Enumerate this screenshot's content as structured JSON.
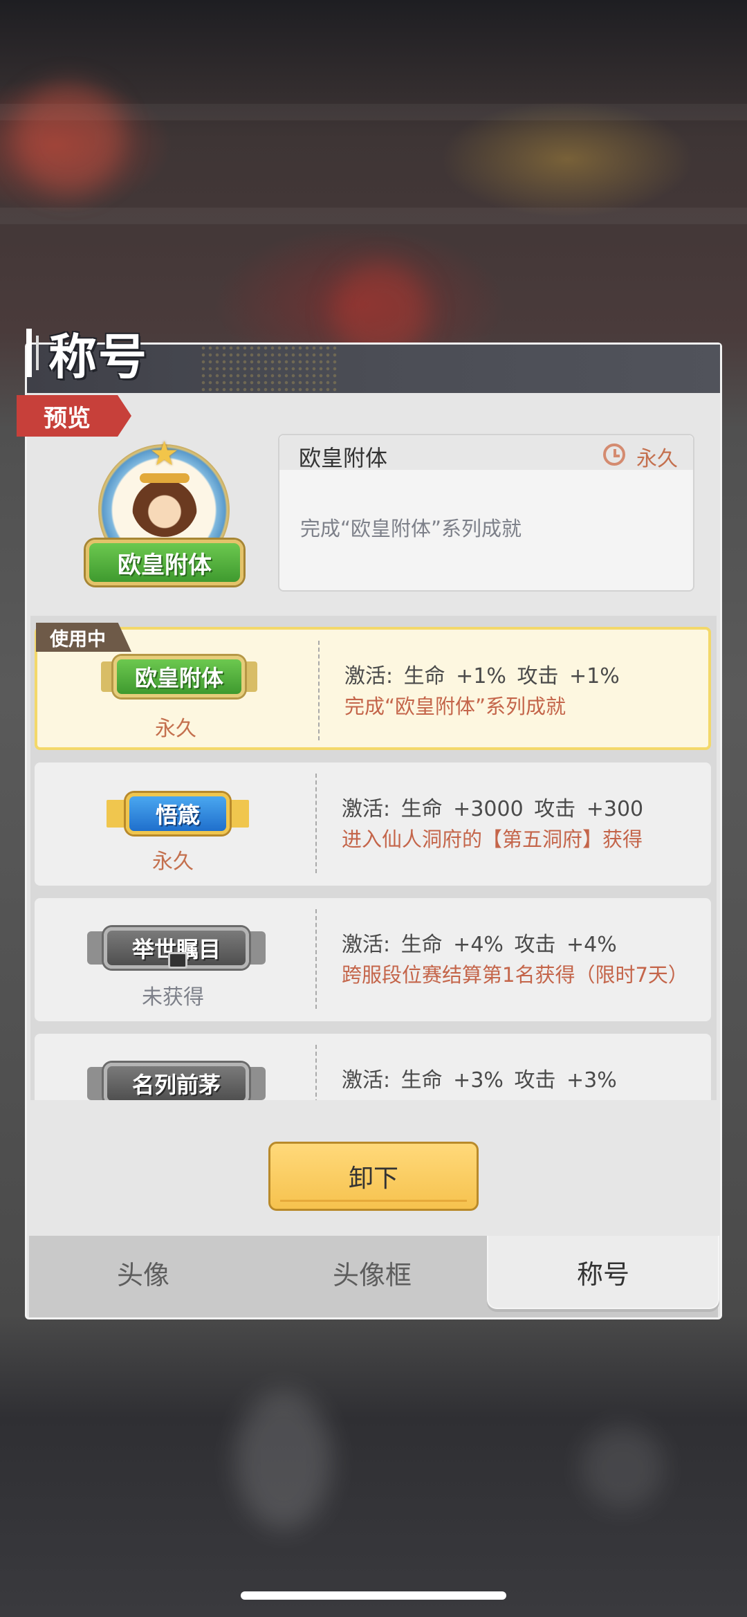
{
  "panel_title": "称号",
  "preview": {
    "tag": "预览",
    "badge_text": "欧皇附体",
    "title_name": "欧皇附体",
    "duration": "永久",
    "description": "完成“欧皇附体”系列成就"
  },
  "in_use_tag": "使用中",
  "titles": [
    {
      "badge": "欧皇附体",
      "badge_style": "green",
      "duration": "永久",
      "stat": "激活: 生命 +1% 攻击 +1%",
      "source": "完成“欧皇附体”系列成就",
      "active": true
    },
    {
      "badge": "悟箴",
      "badge_style": "blue",
      "duration": "永久",
      "stat": "激活: 生命 +3000 攻击 +300",
      "source": "进入仙人洞府的【第五洞府】获得",
      "active": false
    },
    {
      "badge": "举世瞩目",
      "badge_style": "gray",
      "duration": "未获得",
      "stat": "激活: 生命 +4% 攻击 +4%",
      "source": "跨服段位赛结算第1名获得（限时7天）",
      "active": false
    },
    {
      "badge": "名列前茅",
      "badge_style": "gray",
      "duration": "",
      "stat": "激活: 生命 +3% 攻击 +3%",
      "source": "",
      "active": false
    }
  ],
  "unequip_button": "卸下",
  "tabs": [
    {
      "label": "头像",
      "active": false
    },
    {
      "label": "头像框",
      "active": false
    },
    {
      "label": "称号",
      "active": true
    }
  ],
  "colors": {
    "accent_red": "#c7403a",
    "gold_button": "#f6c24e",
    "source_text": "#c4654a",
    "active_row": "#fdf7e0"
  }
}
